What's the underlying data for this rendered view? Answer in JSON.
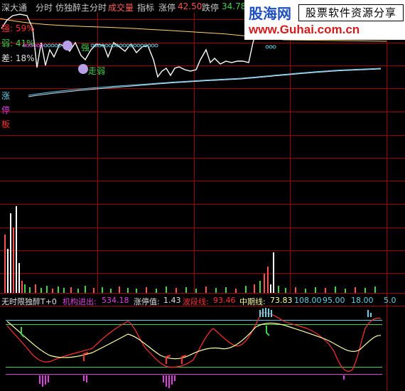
{
  "topbar": {
    "market": "深大通",
    "mode": "分时",
    "indicator_name": "仿独醉主分时",
    "turnover_label": "成交量",
    "index_label": "指标",
    "limit_up_label": "涨停",
    "limit_up_value": "42.50",
    "limit_down_label": "跌停",
    "limit_down_value": "34.78"
  },
  "watermark": {
    "logo": "股海网",
    "tagline": "股票软件资源分享",
    "url": "www.Guhai.com.cn"
  },
  "price_panel": {
    "strong_label": "强: 59%",
    "weak_label": "弱: 41%",
    "diff_label": "差: 18%",
    "weak_marker": "走弱",
    "strong_marker": "强",
    "side_labels": [
      "涨",
      "停",
      "板"
    ]
  },
  "indicator_bar": {
    "title": "无时限独醉T+0",
    "inst_label": "机构进出:",
    "inst_value": "534.18",
    "limit_label": "涨停值:",
    "limit_value": "1.43",
    "wave_label": "波段线:",
    "wave_value": "93.46",
    "mid_label": "中期线:",
    "mid_value": "73.83",
    "level1": "108.00",
    "level2": "95.00",
    "level3": "18.00",
    "level4": "5.0"
  },
  "colors": {
    "grid": "#a00000",
    "price": "#ffffff",
    "avg": "#ffd36b",
    "cyan": "#5fd3e8",
    "green": "#3fd24a",
    "magenta": "#e040e0",
    "red": "#ff3030",
    "yellow": "#ffff00"
  }
}
